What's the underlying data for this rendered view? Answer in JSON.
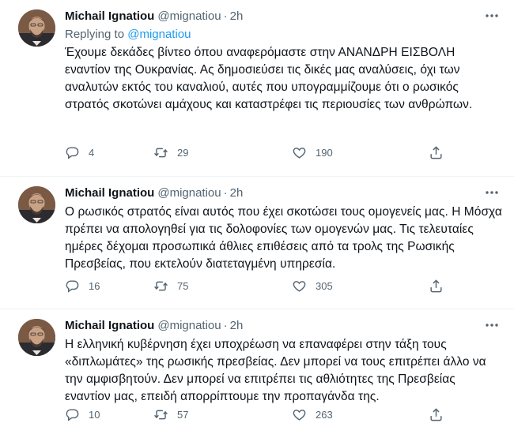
{
  "tweets": [
    {
      "author_name": "Michail Ignatiou",
      "handle": "@mignatiou",
      "separator": "·",
      "time": "2h",
      "replying_label": "Replying to",
      "replying_to": "@mignatiou",
      "text": "Έχουμε δεκάδες βίντεο όπου αναφερόμαστε στην ΑΝΑΝΔΡΗ ΕΙΣΒΟΛΗ εναντίον της Ουκρανίας. Ας δημοσιεύσει τις δικές μας αναλύσεις, όχι των αναλυτών εκτός του καναλιού, αυτές που υπογραμμίζουμε ότι ο ρωσικός στρατός σκοτώνει αμάχους και καταστρέφει τις περιουσίες των ανθρώπων.",
      "replies": "4",
      "retweets": "29",
      "likes": "190"
    },
    {
      "author_name": "Michail Ignatiou",
      "handle": "@mignatiou",
      "separator": "·",
      "time": "2h",
      "text": "Ο ρωσικός στρατός είναι αυτός που έχει σκοτώσει τους ομογενείς μας. Η Μόσχα πρέπει να απολογηθεί για τις δολοφονίες των ομογενών μας. Τις τελευταίες ημέρες δέχομαι προσωπικά άθλιες επιθέσεις από τα τρολς της Ρωσικής Πρεσβείας, που εκτελούν διατεταγμένη υπηρεσία.",
      "replies": "16",
      "retweets": "75",
      "likes": "305"
    },
    {
      "author_name": "Michail Ignatiou",
      "handle": "@mignatiou",
      "separator": "·",
      "time": "2h",
      "text": "Η ελληνική κυβέρνηση έχει υποχρέωση να επαναφέρει στην τάξη τους «διπλωμάτες» της ρωσικής πρεσβείας. Δεν μπορεί να τους επιτρέπει άλλο να την αμφισβητούν. Δεν μπορεί να επιτρέπει τις αθλιότητες της Πρεσβείας εναντίον μας, επειδή απορρίπτουμε την προπαγάνδα της.",
      "replies": "10",
      "retweets": "57",
      "likes": "263"
    }
  ],
  "icons": {
    "reply": "reply-icon",
    "retweet": "retweet-icon",
    "like": "heart-icon",
    "share": "share-icon",
    "more": "more-icon"
  },
  "colors": {
    "text": "#0f1419",
    "secondary": "#536471",
    "link": "#1d9bf0",
    "divider": "#eff3f4"
  }
}
